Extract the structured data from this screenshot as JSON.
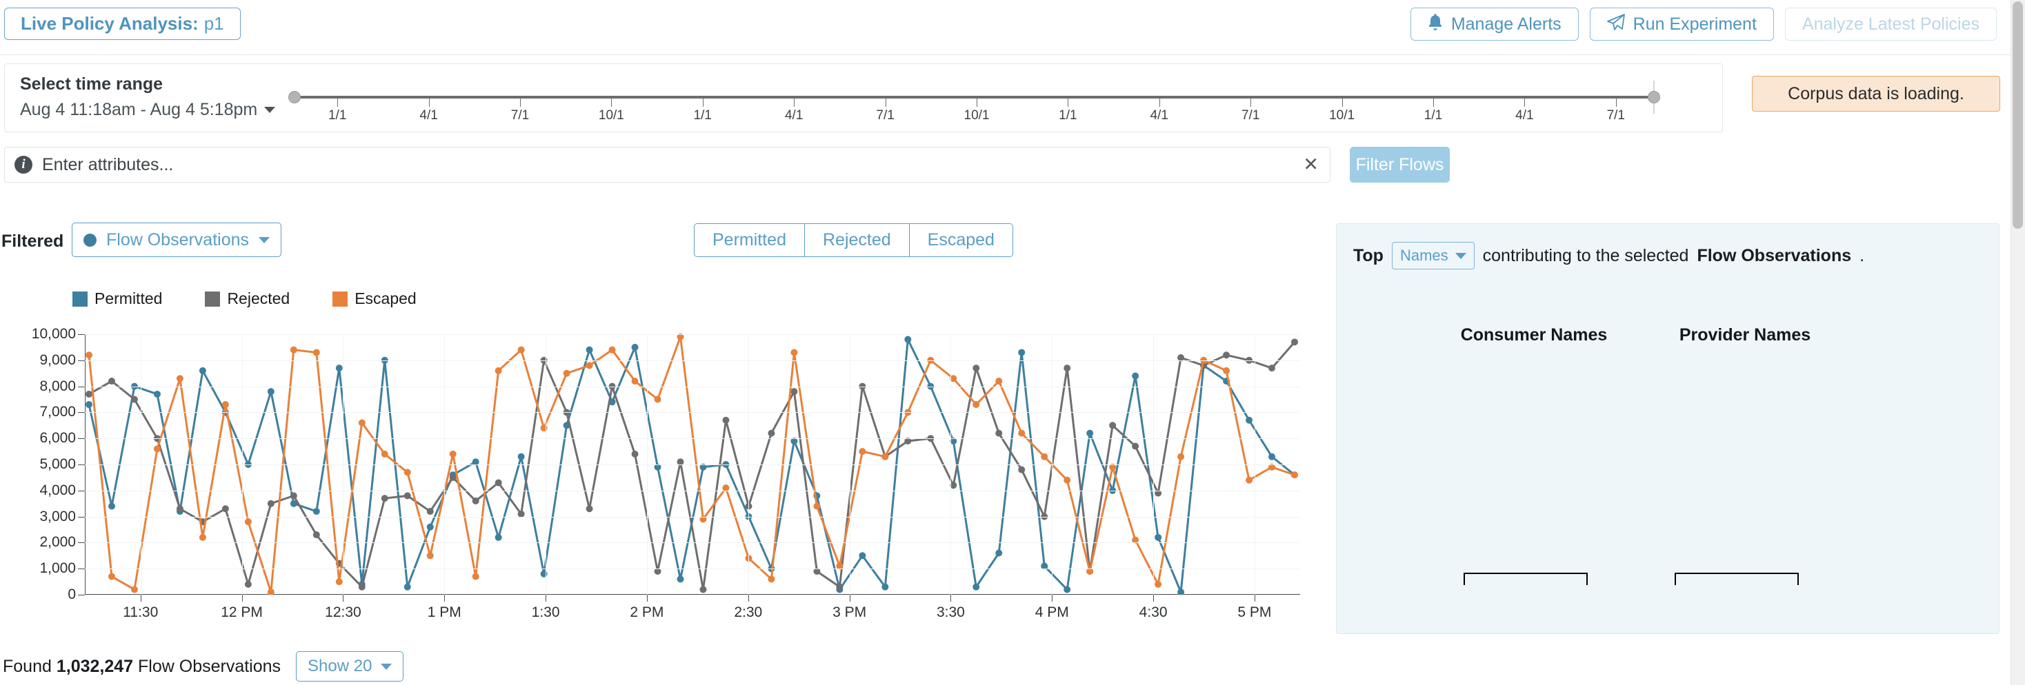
{
  "header": {
    "title_prefix": "Live Policy Analysis:",
    "title_value": "p1",
    "buttons": [
      {
        "label": "Manage Alerts",
        "icon": "bell-icon",
        "disabled": false
      },
      {
        "label": "Run Experiment",
        "icon": "paper-plane-icon",
        "disabled": false
      },
      {
        "label": "Analyze Latest Policies",
        "icon": "none",
        "disabled": true
      }
    ]
  },
  "time_range": {
    "label": "Select time range",
    "value": "Aug 4 11:18am - Aug 4 5:18pm",
    "slider_ticks": [
      "1/1",
      "4/1",
      "7/1",
      "10/1",
      "1/1",
      "4/1",
      "7/1",
      "10/1",
      "1/1",
      "4/1",
      "7/1",
      "10/1",
      "1/1",
      "4/1",
      "7/1"
    ],
    "banner": "Corpus data is loading.",
    "banner_bg": "#fbe6d4",
    "banner_border": "#e8a868"
  },
  "attributes": {
    "placeholder": "Enter attributes...",
    "value": "",
    "clear_label": "✕",
    "info_icon": "info-icon",
    "filter_button": "Filter Flows",
    "filter_button_color": "#9fcde6"
  },
  "controls": {
    "filtered_label": "Filtered",
    "observations_dropdown": "Flow Observations",
    "observations_dot_color": "#3d7f9e",
    "segments": [
      "Permitted",
      "Rejected",
      "Escaped"
    ]
  },
  "right_panel": {
    "top_label": "Top",
    "dropdown": "Names",
    "mid_text": "contributing to the selected",
    "emphasis": "Flow Observations",
    "period": ".",
    "columns": [
      "Consumer Names",
      "Provider Names"
    ]
  },
  "footer": {
    "found_prefix": "Found",
    "count": "1,032,247",
    "found_suffix": "Flow Observations",
    "show_dropdown": "Show 20"
  },
  "chart_data": {
    "type": "line",
    "title": "",
    "xlabel": "",
    "ylabel": "",
    "ylim": [
      0,
      10000
    ],
    "yticks": [
      0,
      1000,
      2000,
      3000,
      4000,
      5000,
      6000,
      7000,
      8000,
      9000,
      10000
    ],
    "ytick_labels": [
      "0",
      "1,000",
      "2,000",
      "3,000",
      "4,000",
      "5,000",
      "6,000",
      "7,000",
      "8,000",
      "9,000",
      "10,000"
    ],
    "xtick_labels": [
      "11:30",
      "12 PM",
      "12:30",
      "1 PM",
      "1:30",
      "2 PM",
      "2:30",
      "3 PM",
      "3:30",
      "4 PM",
      "4:30",
      "5 PM"
    ],
    "grid": true,
    "legend_position": "top-left",
    "colors": {
      "Permitted": "#3d7f9e",
      "Rejected": "#6e6e6e",
      "Escaped": "#e8813a"
    },
    "series": [
      {
        "name": "Permitted",
        "color": "#3d7f9e",
        "values": [
          7300,
          3400,
          8000,
          7700,
          3200,
          8600,
          7000,
          5000,
          7800,
          3500,
          3200,
          8700,
          400,
          9000,
          300,
          2600,
          4600,
          5100,
          2200,
          5300,
          800,
          6500,
          9400,
          7400,
          9500,
          4900,
          600,
          4900,
          5000,
          3000,
          1000,
          5900,
          3800,
          200,
          1500,
          300,
          9800,
          8000,
          5900,
          300,
          1600,
          9300,
          1100,
          200,
          6200,
          4000,
          8400,
          2200,
          100,
          8800,
          8200,
          6700,
          5300,
          4600
        ]
      },
      {
        "name": "Rejected",
        "color": "#6e6e6e",
        "values": [
          7700,
          8200,
          7500,
          6000,
          3300,
          2800,
          3300,
          400,
          3500,
          3800,
          2300,
          1200,
          300,
          3700,
          3800,
          3200,
          4500,
          3600,
          4300,
          3100,
          9000,
          7000,
          3300,
          8000,
          5400,
          900,
          5100,
          200,
          6700,
          3400,
          6200,
          7800,
          900,
          300,
          8000,
          5300,
          5900,
          6000,
          4200,
          8700,
          6200,
          4800,
          3000,
          8700,
          900,
          6500,
          5700,
          3900,
          9100,
          8800,
          9200,
          9000,
          8700,
          9700
        ]
      },
      {
        "name": "Escaped",
        "color": "#e8813a",
        "values": [
          9200,
          700,
          200,
          5600,
          8300,
          2200,
          7300,
          2800,
          100,
          9400,
          9300,
          500,
          6600,
          5400,
          4700,
          1500,
          5400,
          700,
          8600,
          9400,
          6400,
          8500,
          8800,
          9400,
          8200,
          7500,
          9900,
          2900,
          4100,
          1400,
          600,
          9300,
          3400,
          1100,
          5500,
          5300,
          7000,
          9000,
          8300,
          7300,
          8200,
          6200,
          5300,
          4400,
          900,
          4900,
          2100,
          400,
          5300,
          9000,
          8600,
          4400,
          4900,
          4600
        ]
      }
    ]
  }
}
